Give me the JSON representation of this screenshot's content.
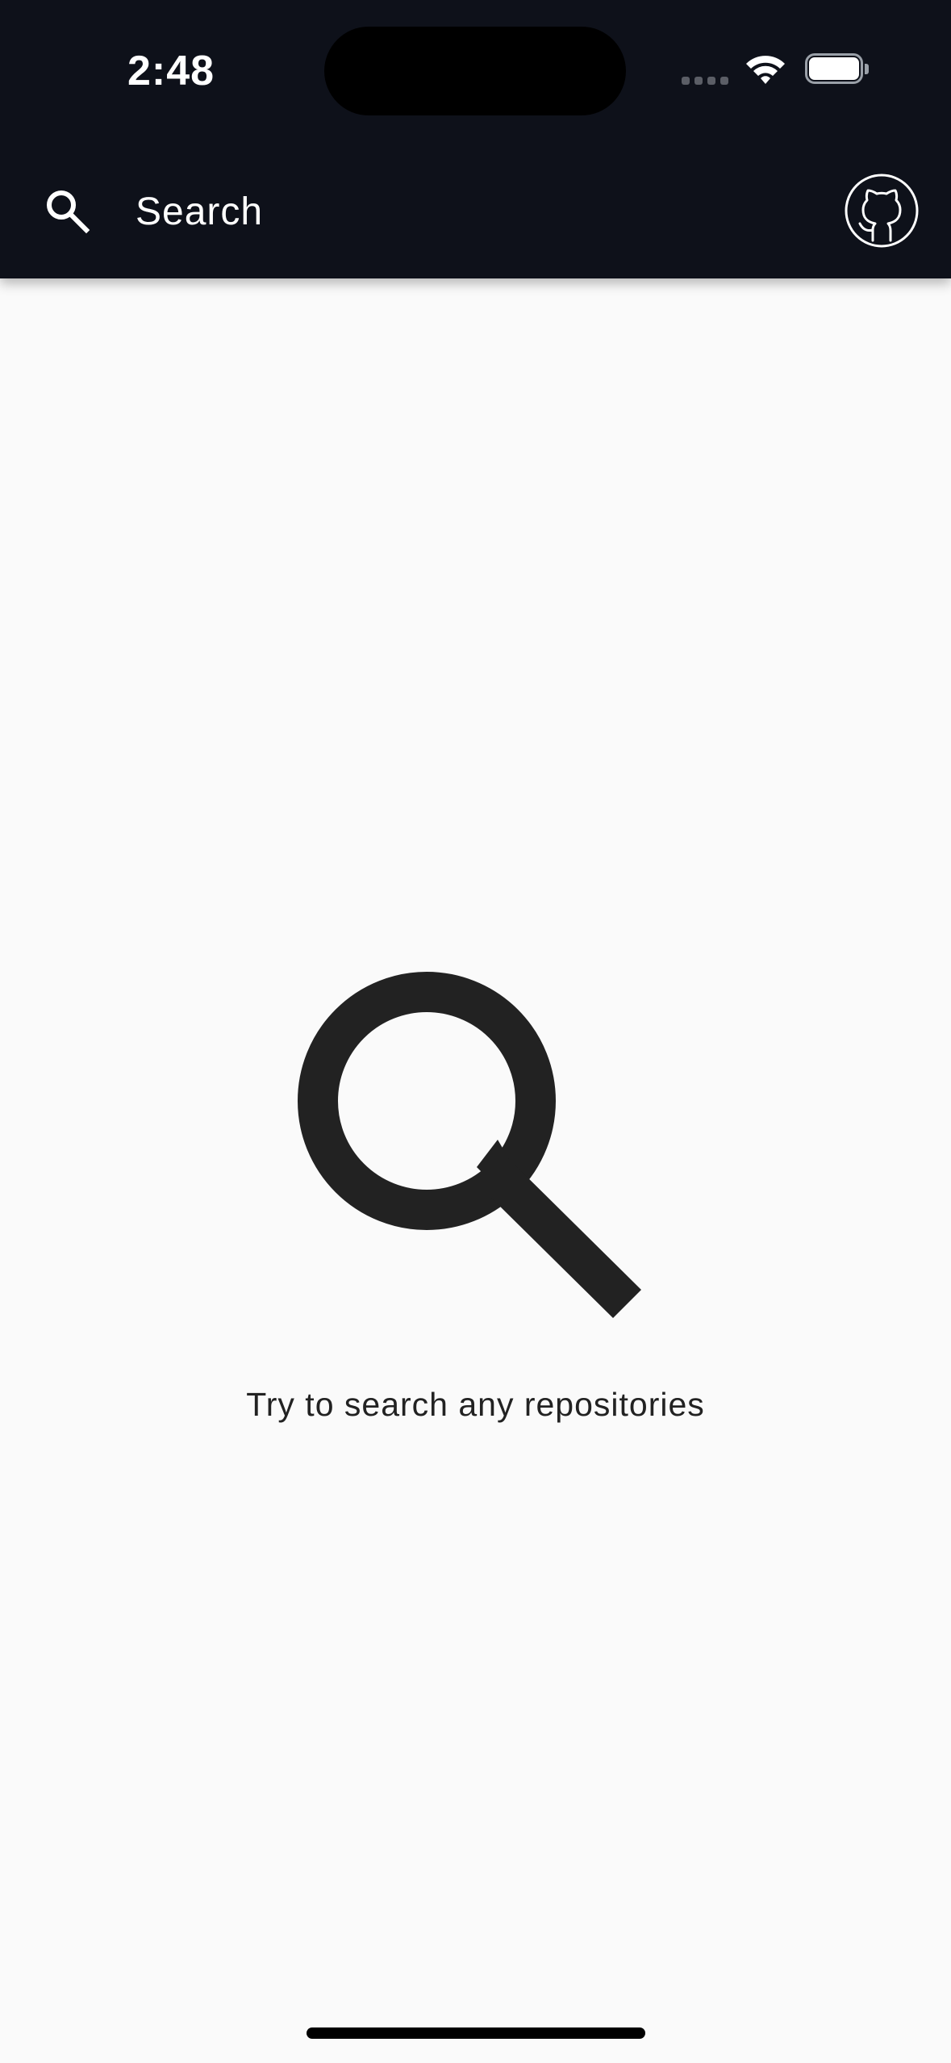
{
  "status_bar": {
    "time": "2:48",
    "icons": [
      "signal-icon",
      "wifi-icon",
      "battery-icon"
    ]
  },
  "app_bar": {
    "search": {
      "placeholder": "Search",
      "value": "",
      "icon": "search-icon"
    },
    "profile_icon": "github-icon"
  },
  "empty_state": {
    "icon": "search-icon",
    "message": "Try to search any repositories"
  },
  "colors": {
    "app_bar_bg": "#0e111a",
    "page_bg": "#fafafa",
    "icon_dark": "#222222",
    "text_light": "#ffffff"
  }
}
